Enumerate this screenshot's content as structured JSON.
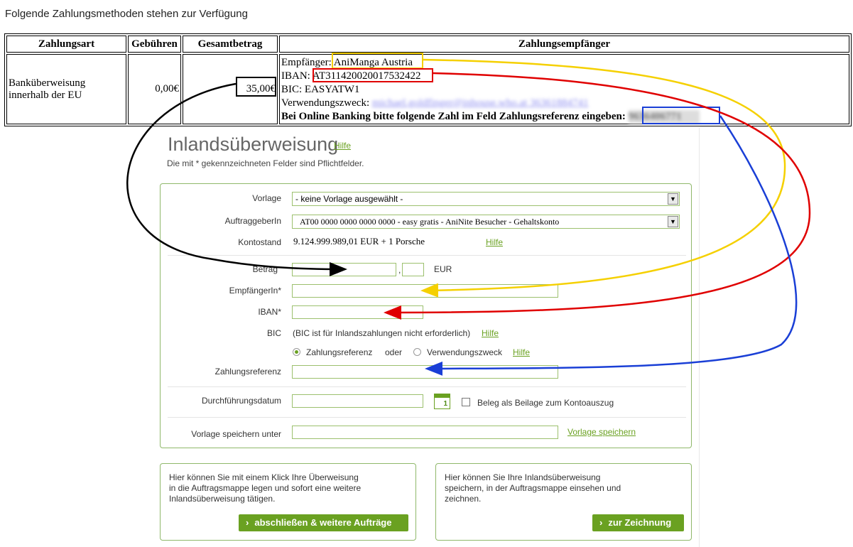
{
  "page": {
    "heading": "Folgende Zahlungsmethoden stehen zur Verfügung"
  },
  "payment_table": {
    "headers": [
      "Zahlungsart",
      "Gebühren",
      "Gesamtbetrag",
      "Zahlungsempfänger"
    ],
    "method": "Banküberweisung innerhalb der EU",
    "fee": "0,00€",
    "total": "35,00€",
    "recipient": {
      "empfaenger_label": "Empfänger:",
      "empfaenger_value": "AniManga Austria",
      "iban_label": "IBAN:",
      "iban_value": "AT311420020017532422",
      "bic_line": "BIC: EASYATW1",
      "verwendungszweck_label": "Verwendungszweck:",
      "verwendungszweck_value": "michael.goldfinger@inhouse.who.at 36361884741",
      "zahlungsreferenz_prompt": "Bei Online Banking bitte folgende Zahl im Feld Zahlungsreferenz eingeben:",
      "zahlungsreferenz_value": "9636406771"
    }
  },
  "form": {
    "title": "Inlandsüberweisung",
    "title_help": "Hilfe",
    "required_note": "Die mit * gekennzeichneten Felder sind Pflichtfelder.",
    "vorlage_label": "Vorlage",
    "vorlage_value": "- keine Vorlage ausgewählt -",
    "auftraggeber_label": "AuftraggeberIn",
    "auftraggeber_value": "AT00 0000 0000 0000 0000 - easy gratis - AniNite Besucher - Gehaltskonto",
    "kontostand_label": "Kontostand",
    "kontostand_value": "9.124.999.989,01 EUR + 1 Porsche",
    "kontostand_help": "Hilfe",
    "betrag_label": "Betrag",
    "betrag_separator": ",",
    "betrag_currency": "EUR",
    "empfaenger_label": "EmpfängerIn*",
    "iban_label": "IBAN*",
    "bic_label": "BIC",
    "bic_note": "(BIC ist für Inlandszahlungen nicht erforderlich)",
    "bic_help": "Hilfe",
    "radio_zahlungsreferenz": "Zahlungsreferenz",
    "radio_oder": "oder",
    "radio_verwendungszweck": "Verwendungszweck",
    "radio_help": "Hilfe",
    "zahlungsreferenz_label": "Zahlungsreferenz",
    "datum_label": "Durchführungsdatum",
    "calendar_icon_number": "1",
    "beilage_label": "Beleg als Beilage zum Kontoauszug",
    "vorlage_speichern_label": "Vorlage speichern unter",
    "vorlage_speichern_link": "Vorlage speichern"
  },
  "info_boxes": [
    {
      "text": "Hier können Sie mit einem Klick Ihre Überweisung\nin die Auftragsmappe legen und sofort eine weitere\nInlandsüberweisung tätigen.",
      "button": "abschließen & weitere Aufträge"
    },
    {
      "text": "Hier können Sie Ihre Inlandsüberweisung\nspeichern, in der Auftragsmappe einsehen und\nzeichnen.",
      "button": "zur Zeichnung"
    }
  ],
  "colors": {
    "accent_green": "#6aa121",
    "annotation_black": "#000000",
    "annotation_yellow": "#f5d000",
    "annotation_red": "#e00000",
    "annotation_blue": "#1a3fd6"
  }
}
